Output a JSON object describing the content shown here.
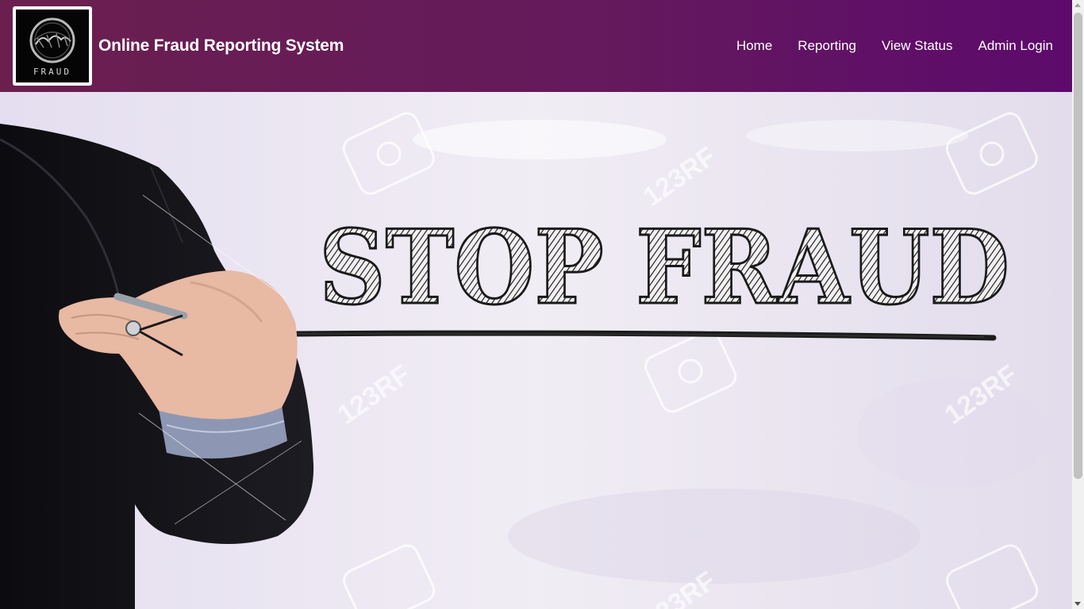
{
  "app": {
    "title": "Online Fraud Reporting System",
    "logo_text": "FRAUD",
    "logo_icon": "fraud-logo-icon"
  },
  "nav": {
    "items": [
      {
        "label": "Home"
      },
      {
        "label": "Reporting"
      },
      {
        "label": "View Status"
      },
      {
        "label": "Admin Login"
      }
    ]
  },
  "hero": {
    "headline": "STOP FRAUD",
    "watermark": "123RF",
    "image": "businessman-writing-stop-fraud"
  },
  "colors": {
    "navbar_start": "#6b1f4f",
    "navbar_end": "#5d0a6c",
    "nav_text": "#ffffff"
  }
}
